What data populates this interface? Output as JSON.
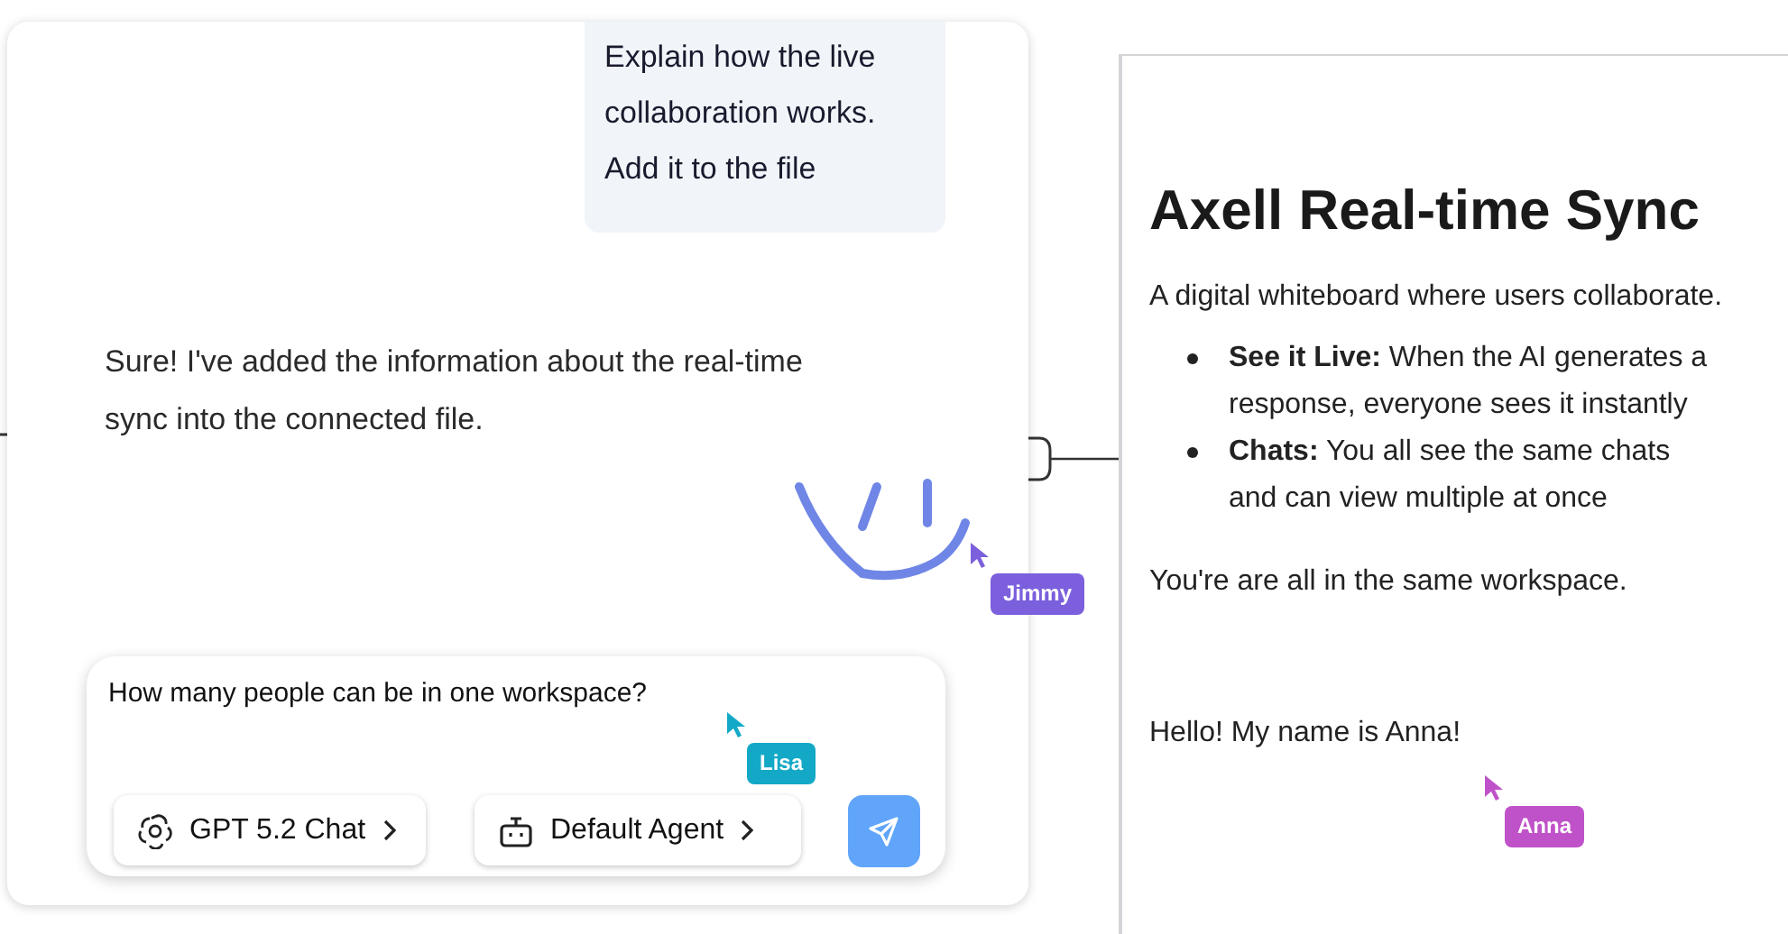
{
  "chat": {
    "messages": [
      {
        "kind": "user",
        "text": "Explain how the live collaboration works. Add it to the file"
      },
      {
        "kind": "assistant",
        "text": "Sure! I've added the information about the real-time sync into the connected file."
      }
    ],
    "composer": {
      "value": "How many people can be in one workspace?",
      "model": "GPT 5.2 Chat",
      "agent": "Default Agent"
    }
  },
  "document": {
    "title": "Axell Real-time Sync",
    "intro": "A digital whiteboard where users collaborate.",
    "bullets": [
      "**See it Live:** When the AI generates a response, everyone sees it instantly",
      "**Chats:** You all see the same chats and can view multiple at once"
    ],
    "paragraphs": [
      "You're are all in the same workspace.",
      "Hello! My name is Anna!"
    ]
  },
  "cursors": [
    {
      "name": "Jimmy",
      "color": "#7b5fdc"
    },
    {
      "name": "Lisa",
      "color": "#13a9c6"
    },
    {
      "name": "Anna",
      "color": "#c052c9"
    }
  ]
}
